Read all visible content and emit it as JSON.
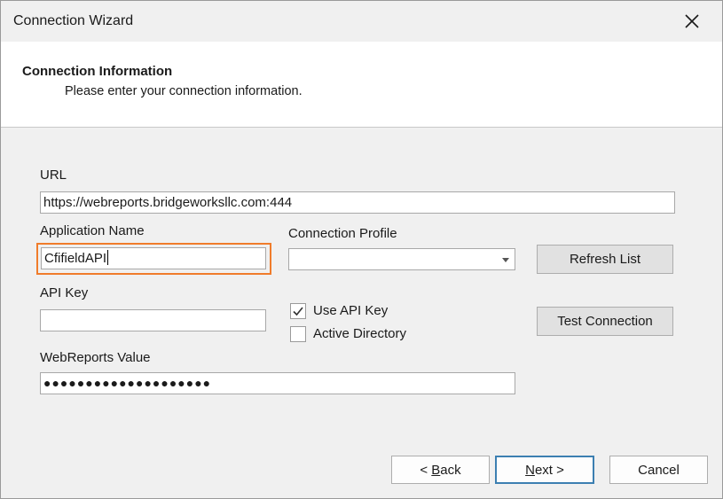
{
  "window": {
    "title": "Connection Wizard"
  },
  "header": {
    "title": "Connection Information",
    "subtitle": "Please enter your connection information."
  },
  "form": {
    "url": {
      "label": "URL",
      "value": "https://webreports.bridgeworksllc.com:444"
    },
    "application_name": {
      "label": "Application Name",
      "value": "CfifieldAPI"
    },
    "connection_profile": {
      "label": "Connection Profile",
      "value": ""
    },
    "api_key": {
      "label": "API Key",
      "value": ""
    },
    "use_api_key": {
      "label": "Use API Key",
      "checked": true
    },
    "active_directory": {
      "label": "Active Directory",
      "checked": false
    },
    "webreports_value": {
      "label": "WebReports Value",
      "masked": "●●●●●●●●●●●●●●●●●●●●"
    }
  },
  "buttons": {
    "refresh_list": "Refresh List",
    "test_connection": "Test Connection",
    "back_prefix": "< ",
    "back_mnemonic": "B",
    "back_rest": "ack",
    "next_mnemonic": "N",
    "next_rest": "ext >",
    "cancel": "Cancel"
  },
  "colors": {
    "focus_ring": "#f07c2b",
    "default_button_border": "#3c7fb1",
    "dialog_background": "#f0f0f0"
  }
}
